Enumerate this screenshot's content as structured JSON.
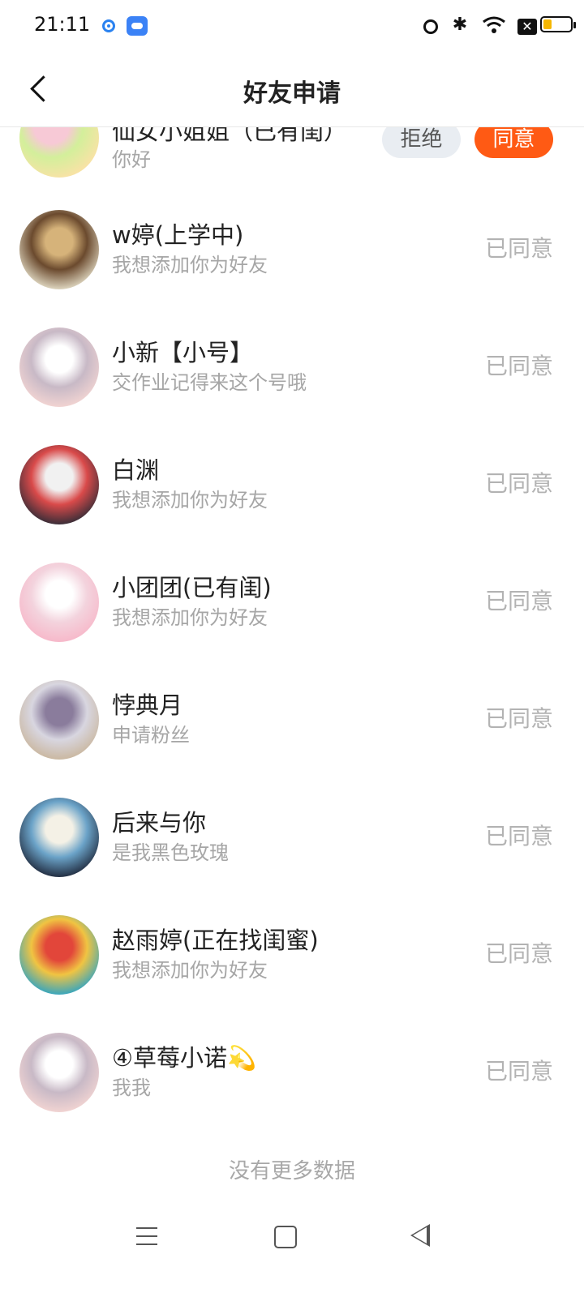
{
  "status_bar": {
    "time": "21:11",
    "icons": [
      "app-dot-icon",
      "cloud-app-icon",
      "alarm-icon",
      "bluetooth-icon",
      "wifi-icon",
      "sim-x-icon",
      "battery-icon"
    ],
    "battery_level": 0.25,
    "battery_color": "#f5b700"
  },
  "header": {
    "title": "好友申请",
    "back_icon": "chevron-left-icon"
  },
  "pending": {
    "name": "仙女小姐姐（已有闺）",
    "message": "你好",
    "reject_label": "拒绝",
    "accept_label": "同意",
    "accept_color": "#ff5a14",
    "avatar_colors": [
      "#f7e3a5",
      "#d3ef9b",
      "#f7c9d6"
    ]
  },
  "requests": [
    {
      "name": "w婷(上学中)",
      "message": "我想添加你为好友",
      "status": "已同意",
      "avatar_colors": [
        "#e8e2cc",
        "#6b4a2e",
        "#d6b37a"
      ]
    },
    {
      "name": "小新【小号】",
      "message": "交作业记得来这个号哦",
      "status": "已同意",
      "avatar_colors": [
        "#f5d6d3",
        "#c8b9c6",
        "#ffffff"
      ]
    },
    {
      "name": "白渊",
      "message": "我想添加你为好友",
      "status": "已同意",
      "avatar_colors": [
        "#2b2b36",
        "#d94a4a",
        "#f1f1f1"
      ]
    },
    {
      "name": "小团团(已有闺)",
      "message": "我想添加你为好友",
      "status": "已同意",
      "avatar_colors": [
        "#f7b6c8",
        "#f3d3dd",
        "#ffffff"
      ]
    },
    {
      "name": "悖典月",
      "message": "申请粉丝",
      "status": "已同意",
      "avatar_colors": [
        "#c9b59b",
        "#d8d6e0",
        "#8a7c9c"
      ]
    },
    {
      "name": "后来与你",
      "message": "是我黑色玫瑰",
      "status": "已同意",
      "avatar_colors": [
        "#1c2436",
        "#6ba3c8",
        "#f4f1e6"
      ]
    },
    {
      "name": "赵雨婷(正在找闺蜜)",
      "message": "我想添加你为好友",
      "status": "已同意",
      "avatar_colors": [
        "#27a3c9",
        "#f0c442",
        "#e2463a"
      ]
    },
    {
      "name": "④草莓小诺💫",
      "message": "我我",
      "status": "已同意",
      "avatar_colors": [
        "#f5d6d3",
        "#c8b9c6",
        "#ffffff"
      ]
    }
  ],
  "footer": {
    "no_more": "没有更多数据"
  },
  "nav": {
    "icons": [
      "menu-icon",
      "home-square-icon",
      "back-triangle-icon"
    ]
  }
}
